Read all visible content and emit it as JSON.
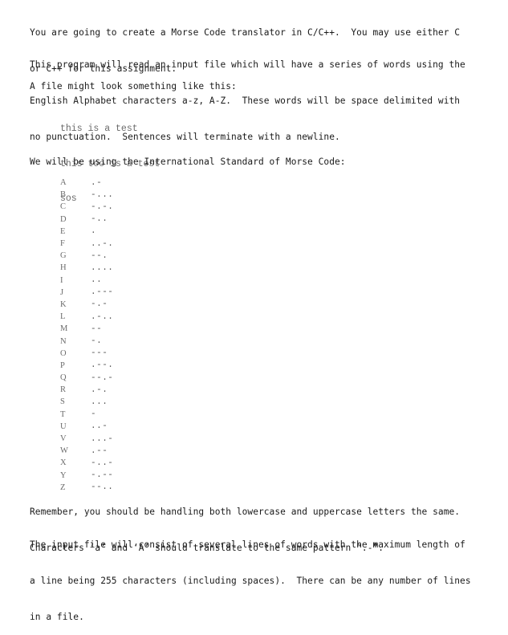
{
  "document": {
    "intro": {
      "line1": "You are going to create a Morse Code translator in C/C++.  You may use either C",
      "line2": "or C++ for this assignment."
    },
    "input_description": {
      "line1": "This program will read an input file which will have a series of words using the",
      "line2": "English Alphabet characters a-z, A-Z.  These words will be space delimited with",
      "line3": "no punctuation.  Sentences will terminate with a newline."
    },
    "example_intro": "A file might look something like this:",
    "example_lines": [
      "this is a test",
      "this too is a test",
      "sos"
    ],
    "morse_intro": "We will be using the International Standard of Morse Code:",
    "morse_table": [
      {
        "letter": "A",
        "code": ".-"
      },
      {
        "letter": "B",
        "code": "-..."
      },
      {
        "letter": "C",
        "code": "-.-."
      },
      {
        "letter": "D",
        "code": "-.."
      },
      {
        "letter": "E",
        "code": "."
      },
      {
        "letter": "F",
        "code": "..-."
      },
      {
        "letter": "G",
        "code": "--."
      },
      {
        "letter": "H",
        "code": "...."
      },
      {
        "letter": "I",
        "code": ".."
      },
      {
        "letter": "J",
        "code": ".---"
      },
      {
        "letter": "K",
        "code": "-.-"
      },
      {
        "letter": "L",
        "code": ".-.."
      },
      {
        "letter": "M",
        "code": "--"
      },
      {
        "letter": "N",
        "code": "-."
      },
      {
        "letter": "O",
        "code": "---"
      },
      {
        "letter": "P",
        "code": ".--."
      },
      {
        "letter": "Q",
        "code": "--.-"
      },
      {
        "letter": "R",
        "code": ".-."
      },
      {
        "letter": "S",
        "code": "..."
      },
      {
        "letter": "T",
        "code": "-"
      },
      {
        "letter": "U",
        "code": "..-"
      },
      {
        "letter": "V",
        "code": "...-"
      },
      {
        "letter": "W",
        "code": ".--"
      },
      {
        "letter": "X",
        "code": "-..-"
      },
      {
        "letter": "Y",
        "code": "-.--"
      },
      {
        "letter": "Z",
        "code": "--.."
      }
    ],
    "case_note": {
      "line1": "Remember, you should be handling both lowercase and uppercase letters the same.",
      "line2": "Characters ‘a’ and ‘A’ should translate to the same pattern “.-”."
    },
    "file_note": {
      "line1": "The input file will consist of several lines of words with the maximum length of",
      "line2": "a line being 255 characters (including spaces).  There can be any number of lines",
      "line3": "in a file."
    }
  }
}
